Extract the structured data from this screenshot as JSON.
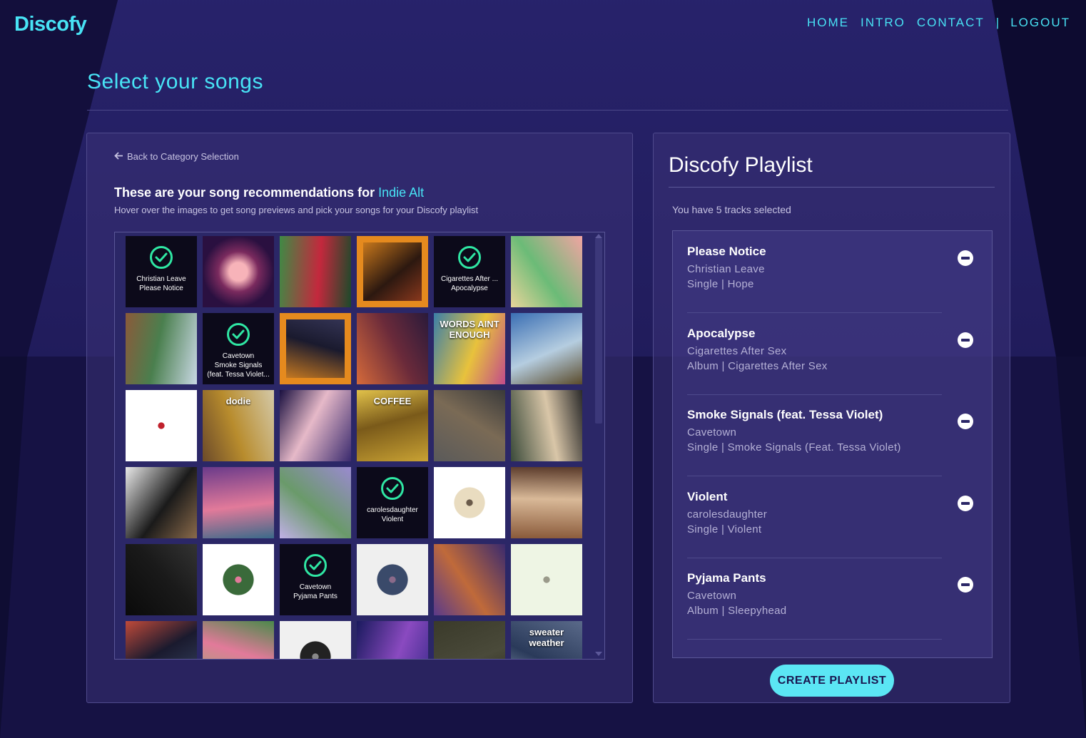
{
  "header": {
    "logo": "Discofy",
    "nav": [
      {
        "label": "HOME"
      },
      {
        "label": "INTRO"
      },
      {
        "label": "CONTACT"
      }
    ],
    "separator": "|",
    "logout": "LOGOUT"
  },
  "page_title": "Select your songs",
  "left_panel": {
    "back_link": "Back to Category Selection",
    "heading_prefix": "These are your song recommendations for ",
    "category": "Indie Alt",
    "subtitle": "Hover over the images to get song previews and pick your songs for your Discofy playlist",
    "tiles": [
      {
        "selected": true,
        "artist": "Christian Leave",
        "title": "Please Notice",
        "colors": [
          "#2a2040",
          "#3a2a50"
        ]
      },
      {
        "selected": false,
        "colors": [
          "#f7b3b9",
          "#7a2a5e",
          "#2a1040"
        ],
        "style": "orb"
      },
      {
        "selected": false,
        "colors": [
          "#3f8a45",
          "#c4283d",
          "#1b4a2a"
        ]
      },
      {
        "selected": false,
        "colors": [
          "#e58a1e",
          "#2c1810",
          "#a04020"
        ],
        "style": "framed"
      },
      {
        "selected": true,
        "artist": "Cigarettes After ...",
        "title": "Apocalypse",
        "colors": [
          "#222",
          "#333"
        ]
      },
      {
        "selected": false,
        "colors": [
          "#f1a4a2",
          "#6bbb77",
          "#e9d59a"
        ]
      },
      {
        "selected": false,
        "colors": [
          "#c9d8e4",
          "#4a7f4e",
          "#8b5a3a"
        ]
      },
      {
        "selected": true,
        "artist": "Cavetown",
        "title": "Smoke Signals (feat. Tessa Violet...",
        "colors": [
          "#222",
          "#333"
        ]
      },
      {
        "selected": false,
        "colors": [
          "#e58a1e",
          "#1a1a2e",
          "#3a3a5e"
        ],
        "style": "framed"
      },
      {
        "selected": false,
        "colors": [
          "#d56a3a",
          "#6a2a3a",
          "#2a1a3a"
        ]
      },
      {
        "selected": false,
        "colors": [
          "#3c7fa8",
          "#e8c23c",
          "#c24b8a"
        ],
        "text": "WORDS AINT ENOUGH"
      },
      {
        "selected": false,
        "colors": [
          "#3b6fb4",
          "#b5cde0",
          "#5a4a2a"
        ]
      },
      {
        "selected": false,
        "colors": [
          "#ffffff",
          "#ffffff",
          "#c0212c"
        ],
        "style": "white"
      },
      {
        "selected": false,
        "colors": [
          "#d4c9a8",
          "#b88c2d",
          "#6b4a2a"
        ],
        "text": "dodie"
      },
      {
        "selected": false,
        "colors": [
          "#3a2a6e",
          "#e6b9c8",
          "#1a1040"
        ]
      },
      {
        "selected": false,
        "colors": [
          "#c9a233",
          "#7a5a1a",
          "#e2c24a"
        ],
        "text": "COFFEE"
      },
      {
        "selected": false,
        "colors": [
          "#5a5a5a",
          "#7a6a55",
          "#3a3a3a"
        ]
      },
      {
        "selected": false,
        "colors": [
          "#3a4a3a",
          "#d9c6a8",
          "#2a2a2a"
        ]
      },
      {
        "selected": false,
        "colors": [
          "#e9e9e9",
          "#1a1a1a",
          "#8a6a4a"
        ]
      },
      {
        "selected": false,
        "colors": [
          "#6a3a8a",
          "#e27a9a",
          "#3a6a8a"
        ]
      },
      {
        "selected": false,
        "colors": [
          "#9a8ad0",
          "#6a9a6a",
          "#c0b0e6"
        ]
      },
      {
        "selected": true,
        "artist": "carolesdaughter",
        "title": "Violent",
        "colors": [
          "#222",
          "#333"
        ]
      },
      {
        "selected": false,
        "colors": [
          "#ffffff",
          "#e9dcc0",
          "#6a5a4a"
        ],
        "style": "white"
      },
      {
        "selected": false,
        "colors": [
          "#8a5a3a",
          "#d9b998",
          "#5a3a2a"
        ]
      },
      {
        "selected": false,
        "colors": [
          "#0a0a0a",
          "#1a1a1a",
          "#333"
        ]
      },
      {
        "selected": false,
        "colors": [
          "#ffffff",
          "#3a6a3a",
          "#e27a9a"
        ],
        "style": "white"
      },
      {
        "selected": true,
        "artist": "Cavetown",
        "title": "Pyjama Pants",
        "colors": [
          "#222",
          "#333"
        ]
      },
      {
        "selected": false,
        "colors": [
          "#efefef",
          "#3a4a6a",
          "#8a6a8a"
        ],
        "style": "white"
      },
      {
        "selected": false,
        "colors": [
          "#3a2a6e",
          "#c06a3a",
          "#5a3a8a"
        ]
      },
      {
        "selected": false,
        "colors": [
          "#eef5e4",
          "#eef5e4",
          "#9a9a8a"
        ],
        "style": "white"
      },
      {
        "selected": false,
        "colors": [
          "#3a4a6a",
          "#1a1a2e",
          "#c04a3a"
        ]
      },
      {
        "selected": false,
        "colors": [
          "#8ab86a",
          "#e27a9a",
          "#4a8a4a"
        ]
      },
      {
        "selected": false,
        "colors": [
          "#f0f0f0",
          "#222",
          "#888"
        ],
        "style": "white"
      },
      {
        "selected": false,
        "colors": [
          "#1a1a5e",
          "#8a4ac0",
          "#3a2a8a"
        ]
      },
      {
        "selected": false,
        "colors": [
          "#3a3a2a",
          "#4a4a3a",
          "#2a2a1a"
        ]
      },
      {
        "selected": false,
        "colors": [
          "#5a6a8a",
          "#2a3a5a",
          "#8a9ab0"
        ],
        "text": "sweater weather"
      }
    ]
  },
  "right_panel": {
    "title": "Discofy Playlist",
    "count_text": "You have 5 tracks selected",
    "tracks": [
      {
        "name": "Please Notice",
        "artist": "Christian Leave",
        "meta": "Single | Hope"
      },
      {
        "name": "Apocalypse",
        "artist": "Cigarettes After Sex",
        "meta": "Album | Cigarettes After Sex"
      },
      {
        "name": "Smoke Signals (feat. Tessa Violet)",
        "artist": "Cavetown",
        "meta": "Single | Smoke Signals (Feat. Tessa Violet)"
      },
      {
        "name": "Violent",
        "artist": "carolesdaughter",
        "meta": "Single | Violent"
      },
      {
        "name": "Pyjama Pants",
        "artist": "Cavetown",
        "meta": "Album | Sleepyhead"
      }
    ],
    "create_button": "CREATE PLAYLIST"
  },
  "colors": {
    "accent": "#48e3f5",
    "check": "#2fe6a3",
    "background": "#0f0d33",
    "button": "#5be6f4"
  }
}
